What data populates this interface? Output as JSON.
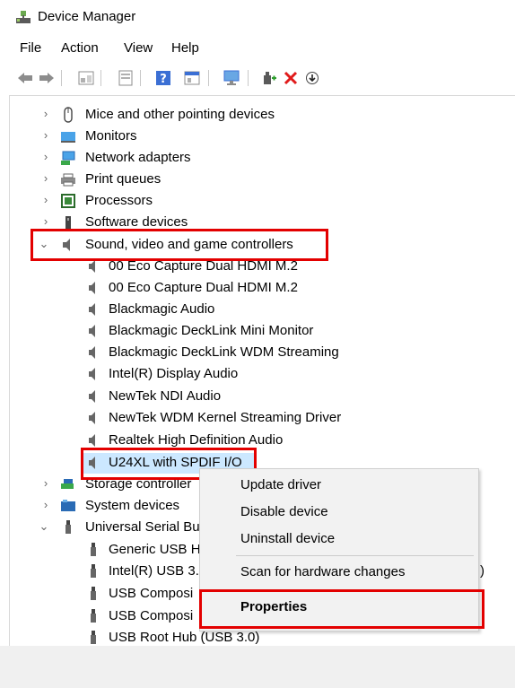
{
  "window": {
    "title": "Device Manager"
  },
  "menu": [
    "File",
    "Action",
    "View",
    "Help"
  ],
  "toolbar": {
    "buttons": [
      "back-icon",
      "forward-icon",
      "properties-pane-icon",
      "device-list-icon",
      "help-icon",
      "view-icon",
      "monitor-icon",
      "add-driver-icon",
      "uninstall-icon",
      "download-icon"
    ]
  },
  "tree": {
    "categories_top": [
      {
        "label": "Mice and other pointing devices",
        "icon": "mouse-icon"
      },
      {
        "label": "Monitors",
        "icon": "monitor-icon"
      },
      {
        "label": "Network adapters",
        "icon": "network-icon"
      },
      {
        "label": "Print queues",
        "icon": "printer-icon"
      },
      {
        "label": "Processors",
        "icon": "processor-icon"
      },
      {
        "label": "Software devices",
        "icon": "software-icon"
      }
    ],
    "sound_category": {
      "label": "Sound, video and game controllers",
      "icon": "speaker-icon"
    },
    "sound_children": [
      "00 Eco Capture Dual HDMI M.2",
      "00 Eco Capture Dual HDMI M.2",
      "Blackmagic Audio",
      "Blackmagic DeckLink Mini Monitor",
      "Blackmagic DeckLink WDM Streaming",
      "Intel(R) Display Audio",
      "NewTek NDI Audio",
      "NewTek WDM Kernel Streaming Driver",
      "Realtek High Definition Audio",
      "U24XL with SPDIF I/O"
    ],
    "categories_bottom": [
      {
        "label": "Storage controller",
        "icon": "storage-icon"
      },
      {
        "label": "System devices",
        "icon": "system-icon"
      },
      {
        "label": "Universal Serial Bu",
        "icon": "usb-icon"
      }
    ],
    "usb_children": [
      "Generic USB H",
      "Intel(R) USB 3.",
      "USB Composi",
      "USB Composi",
      "USB Root Hub (USB 3.0)"
    ],
    "usb_trailing_paren": ")"
  },
  "context_menu": {
    "items": [
      "Update driver",
      "Disable device",
      "Uninstall device",
      "Scan for hardware changes",
      "Properties"
    ]
  },
  "colors": {
    "highlight": "#e30000",
    "selection": "#cce8ff"
  }
}
